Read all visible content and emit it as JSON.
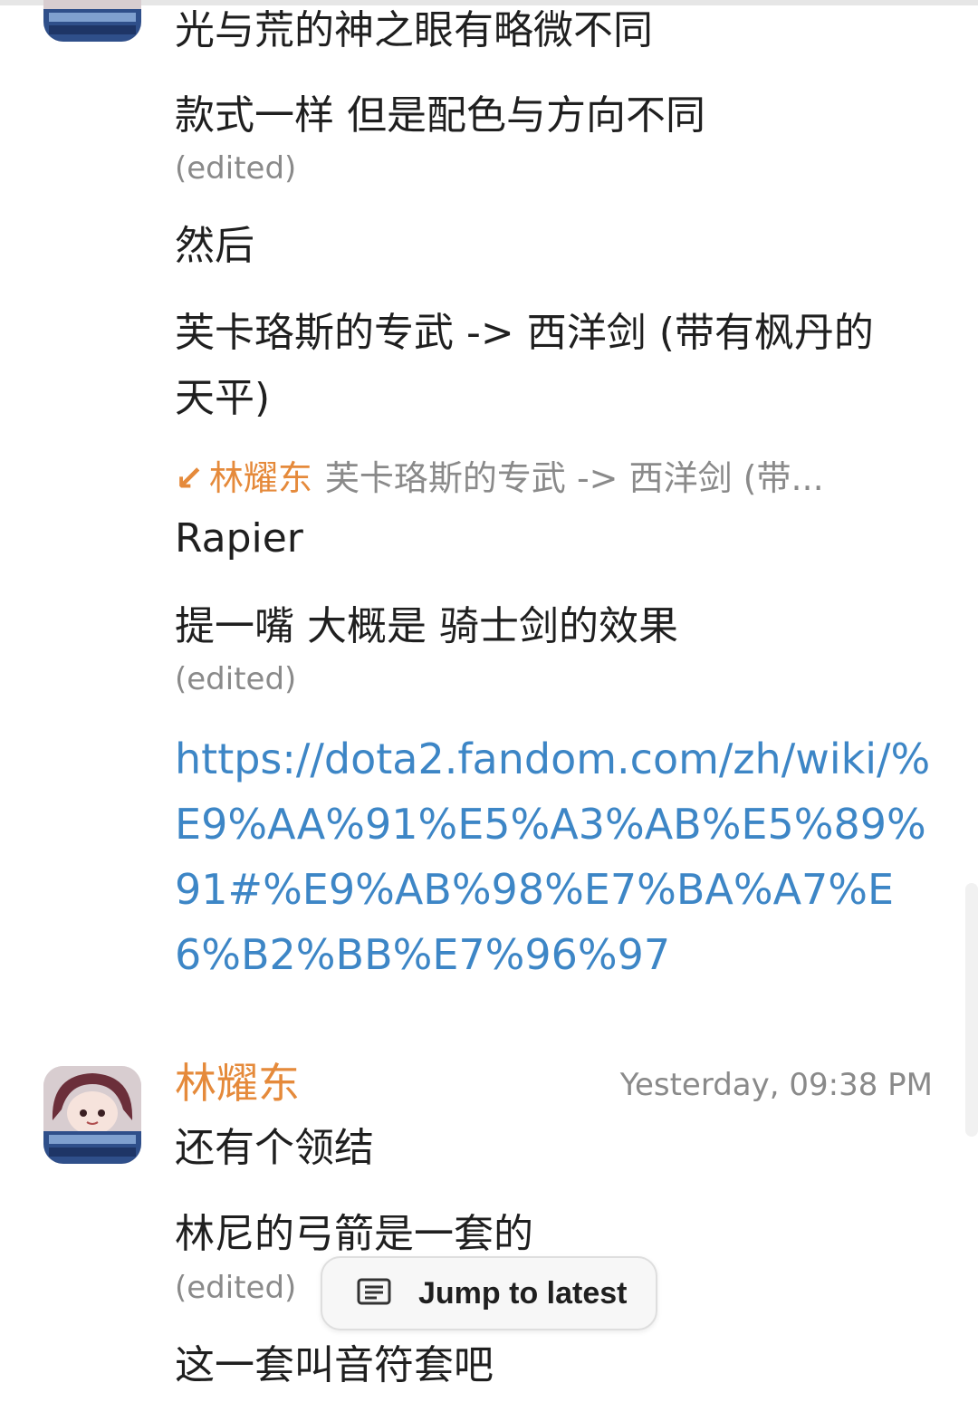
{
  "messages_top": [
    {
      "text": "光与荒的神之眼有略微不同"
    },
    {
      "text": "款式一样 但是配色与方向不同",
      "edited": "(edited)"
    },
    {
      "text": "然后"
    },
    {
      "text_line1": "芙卡珞斯的专武 -> 西洋剑 (带有枫丹的",
      "text_line2": "天平)"
    }
  ],
  "reply": {
    "quote_author": "林耀东",
    "quote_text": "芙卡珞斯的专武 -> 西洋剑 (带...",
    "text": "Rapier"
  },
  "message_after_reply": {
    "text": "提一嘴 大概是 骑士剑的效果",
    "edited": "(edited)"
  },
  "link": {
    "url": "https://dota2.fandom.com/zh/wiki/%E9%AA%91%E5%A3%AB%E5%89%91#%E9%AB%98%E7%BA%A7%E6%B2%BB%E7%96%97"
  },
  "message_group": {
    "author": "林耀东",
    "timestamp": "Yesterday, 09:38 PM",
    "messages": [
      {
        "text": "还有个领结"
      },
      {
        "text": "林尼的弓箭是一套的",
        "edited": "(edited)"
      },
      {
        "text": "这一套叫音符套吧"
      }
    ]
  },
  "jump_button": {
    "label": "Jump to latest",
    "icon": "message-list-icon"
  },
  "colors": {
    "accent_author": "#e58a3b",
    "link": "#3d86c6",
    "muted": "#8a8a8a"
  }
}
